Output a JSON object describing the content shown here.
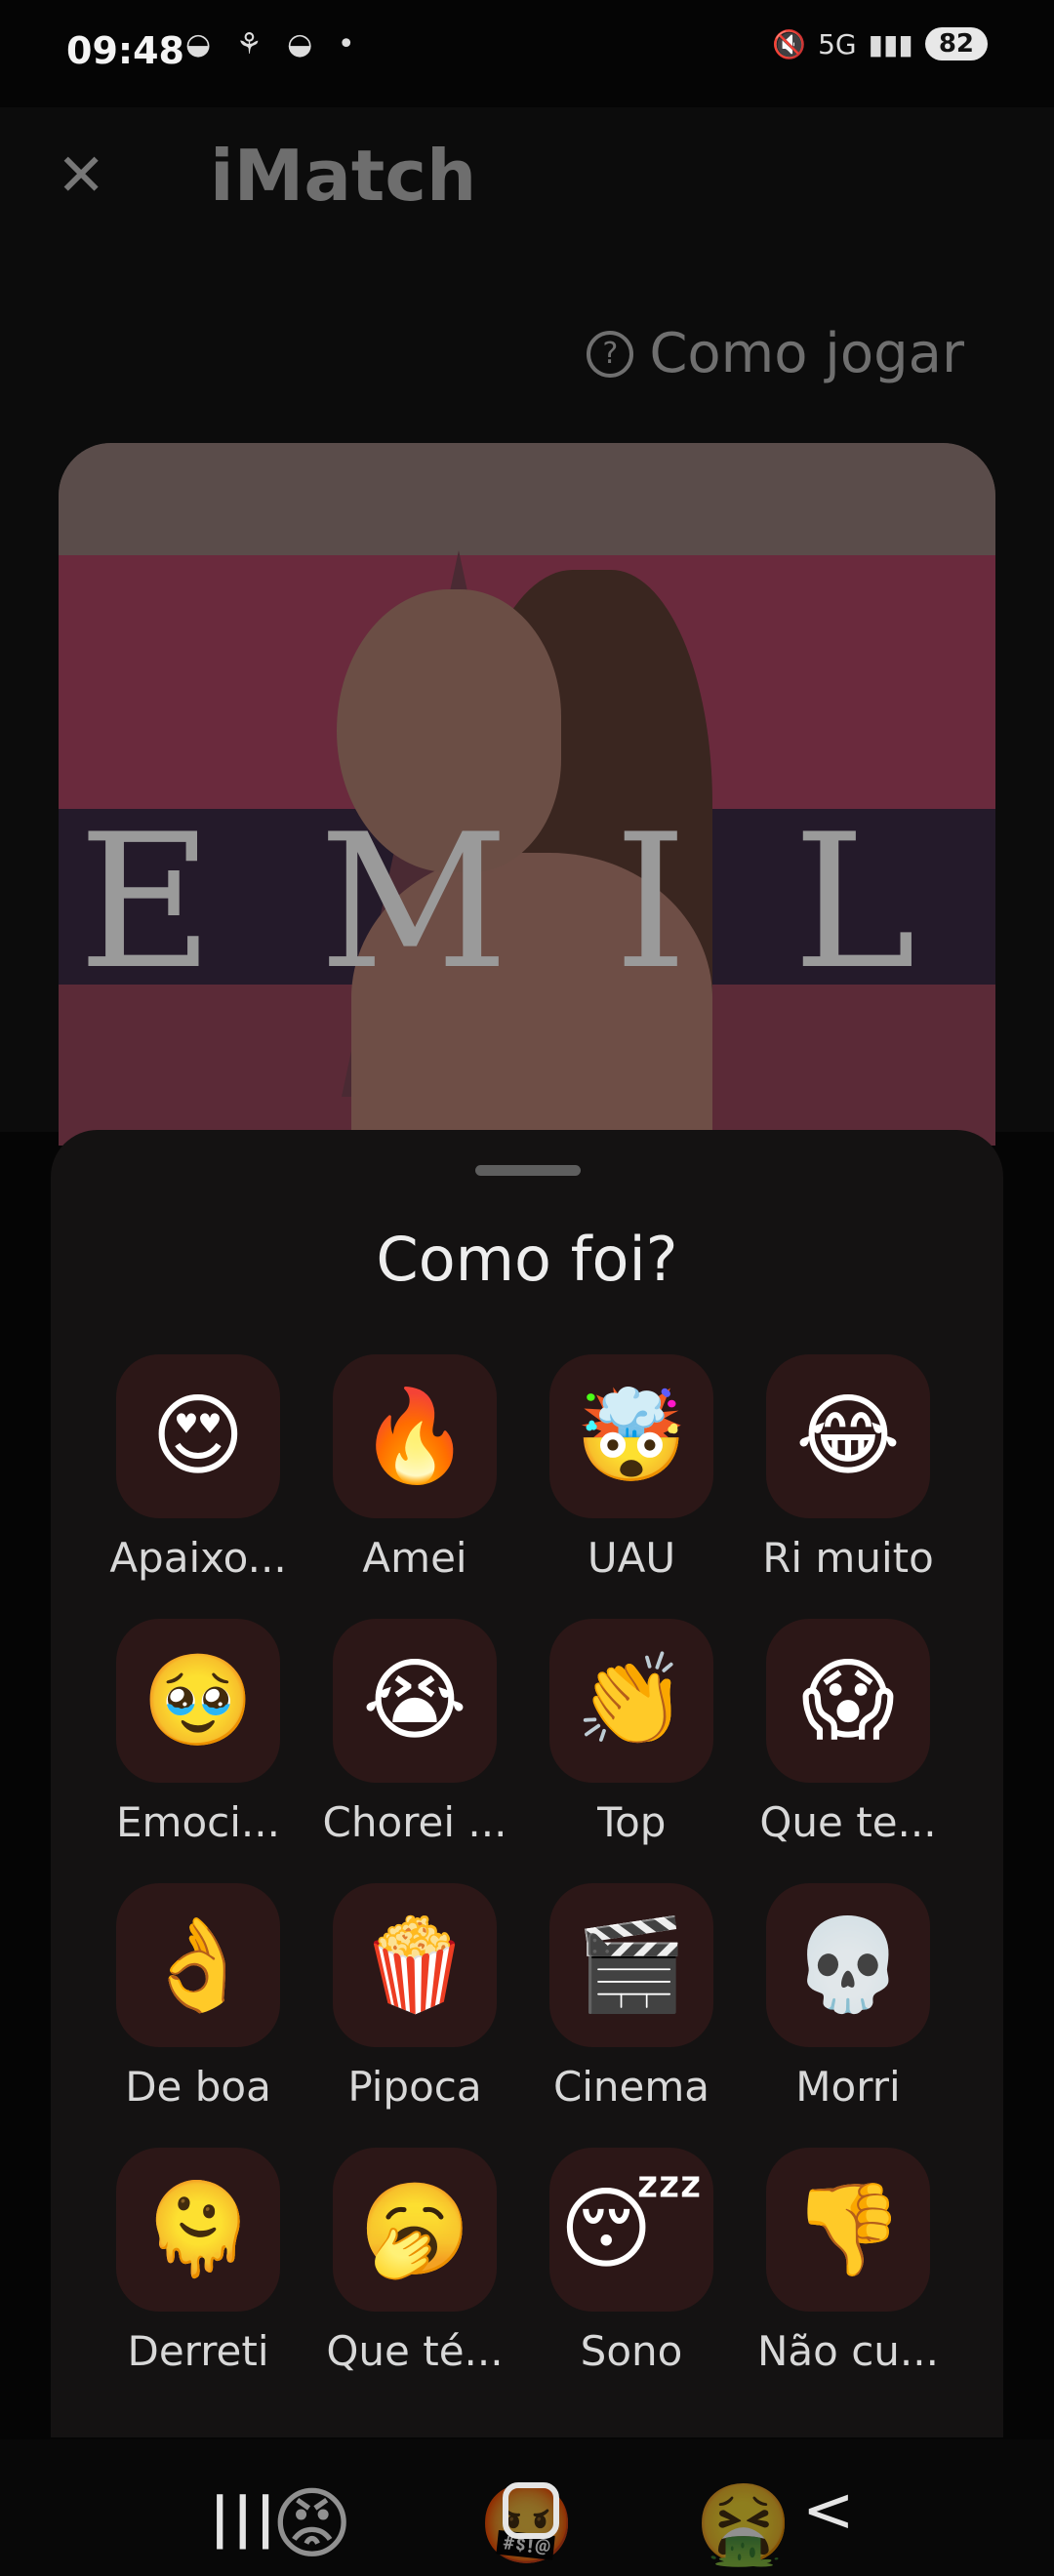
{
  "status_bar": {
    "time": "09:48",
    "left_icons": "◒ ⚘ ◒ •",
    "network": "5G",
    "signal": "▮▮▮",
    "battery": "82"
  },
  "header": {
    "close_icon": "✕",
    "title": "iMatch",
    "how_to_play": "Como jogar",
    "help_icon": "?"
  },
  "poster": {
    "title_text": "EMILY"
  },
  "sheet": {
    "title": "Como foi?",
    "reactions": [
      {
        "emoji": "😍",
        "label": "Apaixo..."
      },
      {
        "emoji": "🔥",
        "label": "Amei"
      },
      {
        "emoji": "🤯",
        "label": "UAU"
      },
      {
        "emoji": "😂",
        "label": "Ri muito"
      },
      {
        "emoji": "🥹",
        "label": "Emoci..."
      },
      {
        "emoji": "😭",
        "label": "Chorei ..."
      },
      {
        "emoji": "👏",
        "label": "Top"
      },
      {
        "emoji": "😱",
        "label": "Que te..."
      },
      {
        "emoji": "👌",
        "label": "De boa"
      },
      {
        "emoji": "🍿",
        "label": "Pipoca"
      },
      {
        "emoji": "🎬",
        "label": "Cinema"
      },
      {
        "emoji": "💀",
        "label": "Morri"
      },
      {
        "emoji": "🫠",
        "label": "Derreti"
      },
      {
        "emoji": "🥱",
        "label": "Que té..."
      },
      {
        "emoji": "😴",
        "label": "Sono"
      },
      {
        "emoji": "👎",
        "label": "Não cu..."
      }
    ]
  },
  "behind_row": [
    "😡",
    "🤬",
    "🤮"
  ],
  "nav_bar": {
    "recent": "|||",
    "back": "<"
  }
}
